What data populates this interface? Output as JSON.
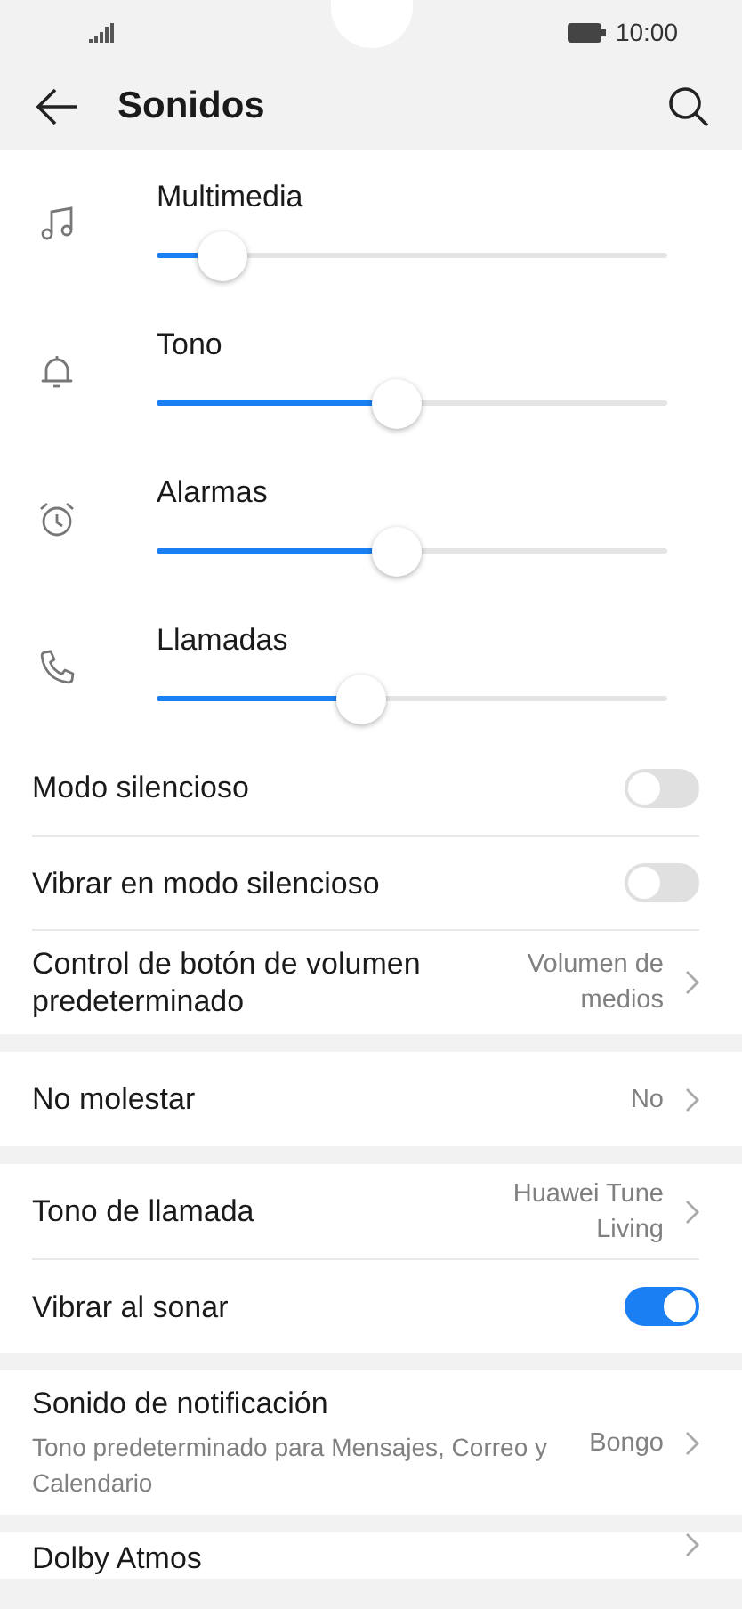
{
  "status_bar": {
    "time": "10:00"
  },
  "header": {
    "title": "Sonidos"
  },
  "volumes": [
    {
      "label": "Multimedia",
      "level": 0.13
    },
    {
      "label": "Tono",
      "level": 0.47
    },
    {
      "label": "Alarmas",
      "level": 0.47
    },
    {
      "label": "Llamadas",
      "level": 0.4
    }
  ],
  "sections": [
    {
      "rows": [
        {
          "kind": "toggle",
          "label": "Modo silencioso",
          "on": false
        },
        {
          "kind": "toggle",
          "label": "Vibrar en modo silencioso",
          "on": false
        },
        {
          "kind": "link",
          "label": "Control de botón de volumen predeterminado",
          "value": "Volumen de medios"
        }
      ]
    },
    {
      "rows": [
        {
          "kind": "link",
          "label": "No molestar",
          "value": "No"
        }
      ]
    },
    {
      "rows": [
        {
          "kind": "link",
          "label": "Tono de llamada",
          "value": "Huawei Tune Living"
        },
        {
          "kind": "toggle",
          "label": "Vibrar al sonar",
          "on": true
        }
      ]
    },
    {
      "rows": [
        {
          "kind": "link",
          "label": "Sonido de notificación",
          "subtitle": "Tono predeterminado para Mensajes, Correo y Calendario",
          "value": "Bongo"
        }
      ]
    },
    {
      "rows": [
        {
          "kind": "link",
          "label": "Dolby Atmos"
        }
      ]
    }
  ]
}
